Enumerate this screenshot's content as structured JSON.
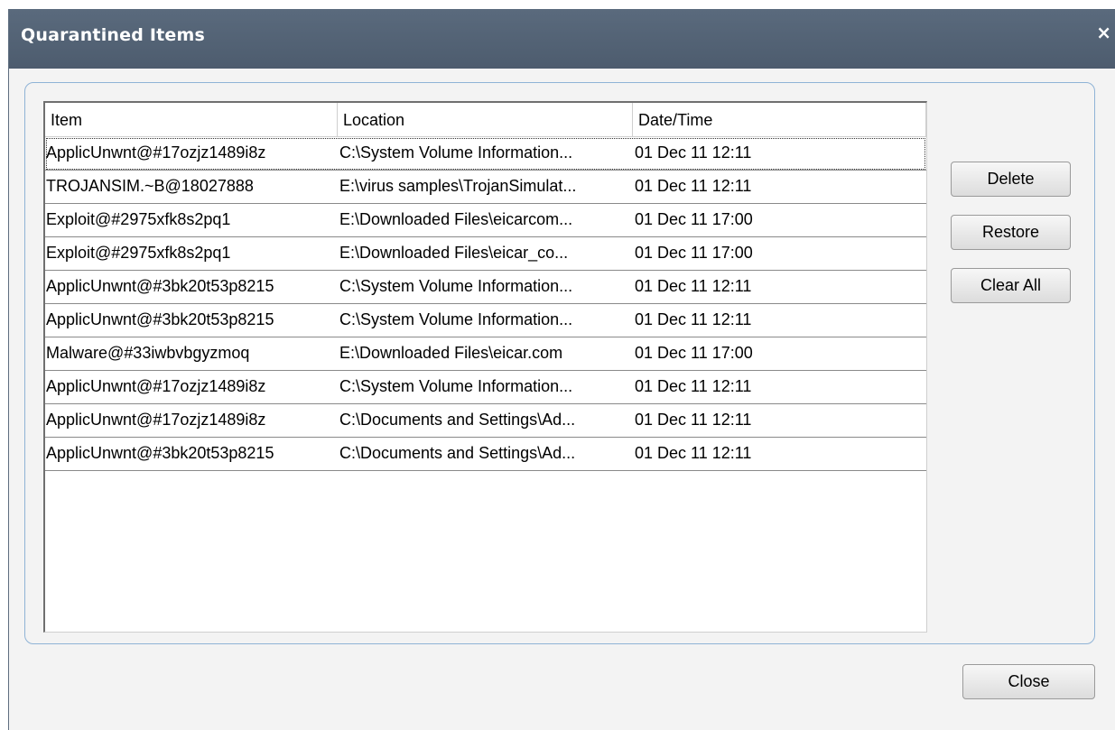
{
  "window": {
    "title": "Quarantined Items",
    "close_icon": "×"
  },
  "table": {
    "columns": [
      "Item",
      "Location",
      "Date/Time"
    ],
    "rows": [
      [
        "ApplicUnwnt@#17ozjz1489i8z",
        "C:\\System Volume Information...",
        "01 Dec 11 12:11"
      ],
      [
        "TROJANSIM.~B@18027888",
        "E:\\virus samples\\TrojanSimulat...",
        "01 Dec 11 12:11"
      ],
      [
        "Exploit@#2975xfk8s2pq1",
        "E:\\Downloaded Files\\eicarcom...",
        "01 Dec 11 17:00"
      ],
      [
        "Exploit@#2975xfk8s2pq1",
        "E:\\Downloaded Files\\eicar_co...",
        "01 Dec 11 17:00"
      ],
      [
        "ApplicUnwnt@#3bk20t53p8215",
        "C:\\System Volume Information...",
        "01 Dec 11 12:11"
      ],
      [
        "ApplicUnwnt@#3bk20t53p8215",
        "C:\\System Volume Information...",
        "01 Dec 11 12:11"
      ],
      [
        "Malware@#33iwbvbgyzmoq",
        "E:\\Downloaded Files\\eicar.com",
        "01 Dec 11 17:00"
      ],
      [
        "ApplicUnwnt@#17ozjz1489i8z",
        "C:\\System Volume Information...",
        "01 Dec 11 12:11"
      ],
      [
        "ApplicUnwnt@#17ozjz1489i8z",
        "C:\\Documents and Settings\\Ad...",
        "01 Dec 11 12:11"
      ],
      [
        "ApplicUnwnt@#3bk20t53p8215",
        "C:\\Documents and Settings\\Ad...",
        "01 Dec 11 12:11"
      ]
    ]
  },
  "buttons": {
    "delete": "Delete",
    "restore": "Restore",
    "clear_all": "Clear All",
    "close": "Close"
  }
}
